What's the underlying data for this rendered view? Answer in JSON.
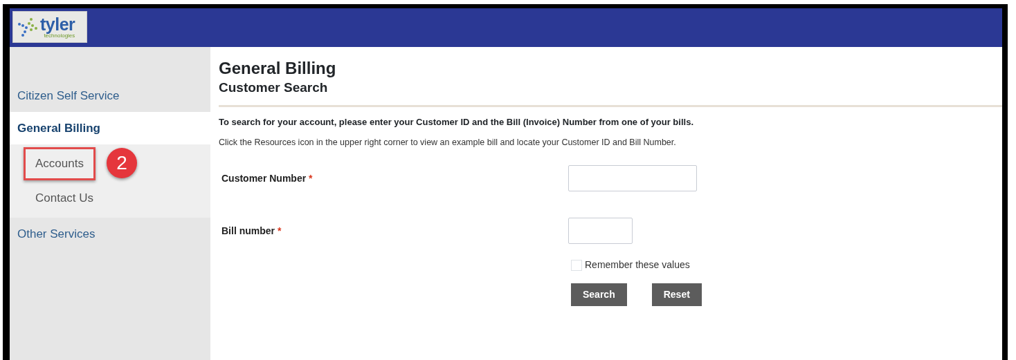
{
  "logo": {
    "name": "tyler",
    "tagline": "technologies"
  },
  "sidebar": {
    "items": [
      {
        "label": "Citizen Self Service",
        "selected": false
      },
      {
        "label": "General Billing",
        "selected": true,
        "children": [
          {
            "label": "Accounts",
            "highlighted": true,
            "callout": "2"
          },
          {
            "label": "Contact Us",
            "highlighted": false
          }
        ]
      },
      {
        "label": "Other Services",
        "selected": false
      }
    ]
  },
  "page": {
    "title": "General Billing",
    "subtitle": "Customer Search",
    "instruction": "To search for your account, please enter your Customer ID and the Bill (Invoice) Number from one of your bills.",
    "hint": "Click the Resources icon in the upper right corner to view an example bill and locate your Customer ID and Bill Number."
  },
  "form": {
    "fields": [
      {
        "label": "Customer Number",
        "required_mark": "*"
      },
      {
        "label": "Bill number",
        "required_mark": "*"
      }
    ],
    "remember": {
      "label": "Remember these values",
      "checked": false
    },
    "buttons": [
      "Search",
      "Reset"
    ]
  }
}
